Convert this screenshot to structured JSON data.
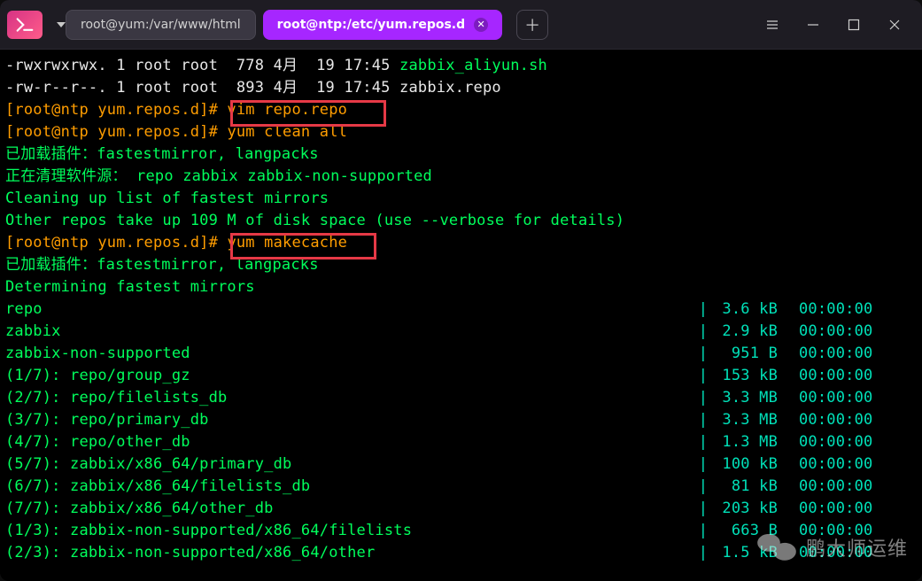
{
  "window": {
    "tabs": [
      {
        "title": "root@yum:/var/www/html",
        "active": false
      },
      {
        "title": "root@ntp:/etc/yum.repos.d",
        "active": true
      }
    ]
  },
  "highlighted_commands": {
    "cmd1": "yum clean all",
    "cmd2": "yum makecache"
  },
  "prompts": {
    "p1": "[root@ntp yum.repos.d]# vim repo.repo",
    "p2": "[root@ntp yum.repos.d]# ",
    "p3": "[root@ntp yum.repos.d]# "
  },
  "lines": {
    "l0a": "-rwxrwxrwx. 1 root root  778 4月  19 17:45 ",
    "l0b": "zabbix_aliyun.sh",
    "l1a": "-rw-r--r--. 1 root root  893 4月  19 17:45 ",
    "l1b": "zabbix.repo",
    "l4": "已加载插件：fastestmirror, langpacks",
    "l5": "正在清理软件源： repo zabbix zabbix-non-supported",
    "l6": "Cleaning up list of fastest mirrors",
    "l7": "Other repos take up 109 M of disk space (use --verbose for details)",
    "l9": "已加载插件：fastestmirror, langpacks",
    "l10": "Determining fastest mirrors"
  },
  "downloads": [
    {
      "name": "repo",
      "size": "3.6 kB",
      "time": "00:00:00"
    },
    {
      "name": "zabbix",
      "size": "2.9 kB",
      "time": "00:00:00"
    },
    {
      "name": "zabbix-non-supported",
      "size": " 951 B",
      "time": "00:00:00"
    },
    {
      "name": "(1/7): repo/group_gz",
      "size": "153 kB",
      "time": "00:00:00"
    },
    {
      "name": "(2/7): repo/filelists_db",
      "size": "3.3 MB",
      "time": "00:00:00"
    },
    {
      "name": "(3/7): repo/primary_db",
      "size": "3.3 MB",
      "time": "00:00:00"
    },
    {
      "name": "(4/7): repo/other_db",
      "size": "1.3 MB",
      "time": "00:00:00"
    },
    {
      "name": "(5/7): zabbix/x86_64/primary_db",
      "size": "100 kB",
      "time": "00:00:00"
    },
    {
      "name": "(6/7): zabbix/x86_64/filelists_db",
      "size": " 81 kB",
      "time": "00:00:00"
    },
    {
      "name": "(7/7): zabbix/x86_64/other_db",
      "size": "203 kB",
      "time": "00:00:00"
    },
    {
      "name": "(1/3): zabbix-non-supported/x86_64/filelists",
      "size": " 663 B",
      "time": "00:00:00"
    },
    {
      "name": "(2/3): zabbix-non-supported/x86_64/other",
      "size": "1.5 kB",
      "time": "00:00:00"
    }
  ],
  "sep": " | ",
  "watermark": "鹏大师运维"
}
